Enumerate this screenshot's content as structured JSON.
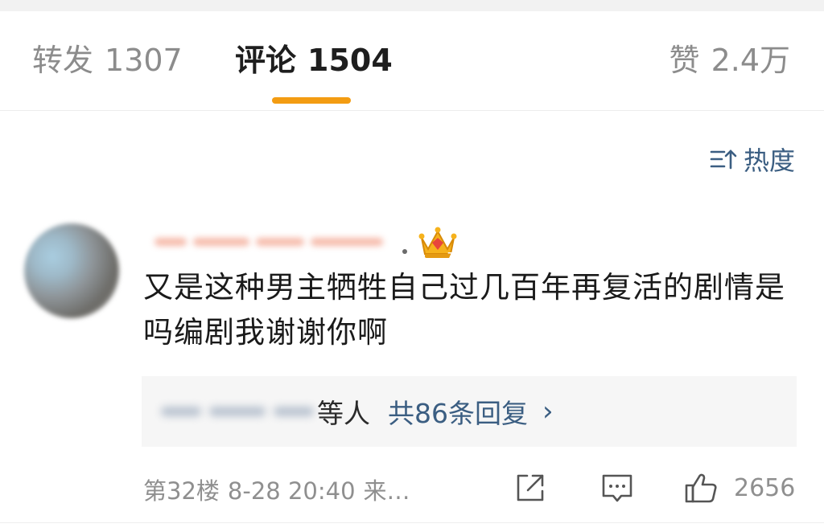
{
  "tabs": [
    {
      "label": "转发",
      "count": "1307"
    },
    {
      "label": "评论",
      "count": "1504"
    },
    {
      "label": "赞",
      "count": "2.4万"
    }
  ],
  "sort": {
    "label": "热度",
    "icon": "sort-icon"
  },
  "comment": {
    "avatar_icon": "user-avatar",
    "badge_icon": "crown-badge-icon",
    "text": "又是这种男主牺牲自己过几百年再复活的剧情是吗编剧我谢谢你啊",
    "replies": {
      "others_label": "等人",
      "total_label": "共86条回复",
      "chevron": "›"
    },
    "meta": {
      "floor": "第32楼",
      "datetime": "8-28 20:40",
      "source": "来…"
    },
    "actions": {
      "share_icon": "share-icon",
      "reply_icon": "comment-icon",
      "like_icon": "thumbs-up-icon",
      "like_count": "2656"
    }
  },
  "colors": {
    "accent": "#f39c12",
    "link": "#3b5e82",
    "muted": "#8f8f8f"
  }
}
